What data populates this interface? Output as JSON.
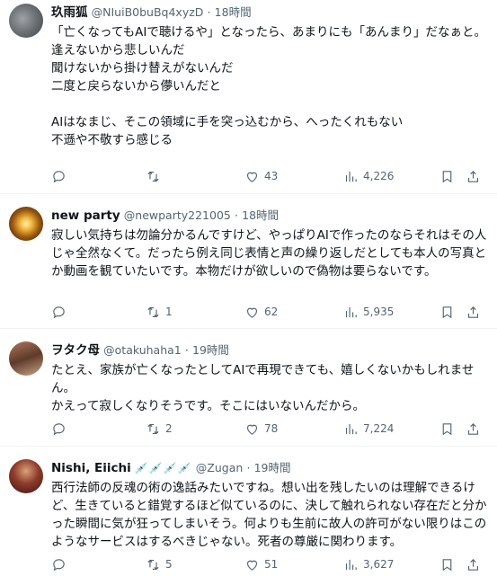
{
  "tweets": [
    {
      "name": "玖雨狐",
      "handle": "@NIuiB0buBq4xyzD",
      "dot": "·",
      "time": "18時間",
      "text": "「亡くなってもAIで聴けるや」となったら、あまりにも「あんまり」だなぁと。\n逢えないから悲しいんだ\n聞けないから掛け替えがないんだ\n二度と戻らないから儚いんだと\n\nAIはなまじ、そこの領域に手を突っ込むから、へったくれもない\n不遜や不敬すら感じる",
      "replies": "",
      "retweets": "",
      "likes": "43",
      "views": "4,226"
    },
    {
      "name": "new party",
      "handle": "@newparty221005",
      "dot": "·",
      "time": "18時間",
      "text": "寂しい気持ちは勿論分かるんですけど、やっぱりAIで作ったのならそれはその人じゃ全然なくて。だったら例え同じ表情と声の繰り返しだとしても本人の写真とか動画を観ていたいです。本物だけが欲しいので偽物は要らないです。",
      "replies": "",
      "retweets": "1",
      "likes": "62",
      "views": "5,935"
    },
    {
      "name": "ヲタク母",
      "handle": "@otakuhaha1",
      "dot": "·",
      "time": "19時間",
      "text": "たとえ、家族が亡くなったとしてAIで再現できても、嬉しくないかもしれません。\nかえって寂しくなりそうです。そこにはいないんだから。",
      "replies": "",
      "retweets": "2",
      "likes": "78",
      "views": "7,224"
    },
    {
      "name": "Nishi, Eiichi",
      "badges": "💉💉💉💉",
      "handle": "@Zugan",
      "dot": "·",
      "time": "19時間",
      "text": "西行法師の反魂の術の逸話みたいですね。想い出を残したいのは理解できるけど、生きていると錯覚するほど似ているのに、決して触れられない存在だと分かった瞬間に気が狂ってしまいそう。何よりも生前に故人の許可がない限りはこのようなサービスはするべきじゃない。死者の尊厳に関わります。",
      "replies": "",
      "retweets": "5",
      "likes": "51",
      "views": "3,627"
    }
  ],
  "icons": {
    "reply": "reply-icon",
    "retweet": "retweet-icon",
    "like": "heart-icon",
    "views": "views-chart-icon",
    "bookmark": "bookmark-icon",
    "share": "share-icon"
  },
  "colors": {
    "text": "#0f1419",
    "muted": "#536471",
    "divider": "#eff3f4"
  }
}
